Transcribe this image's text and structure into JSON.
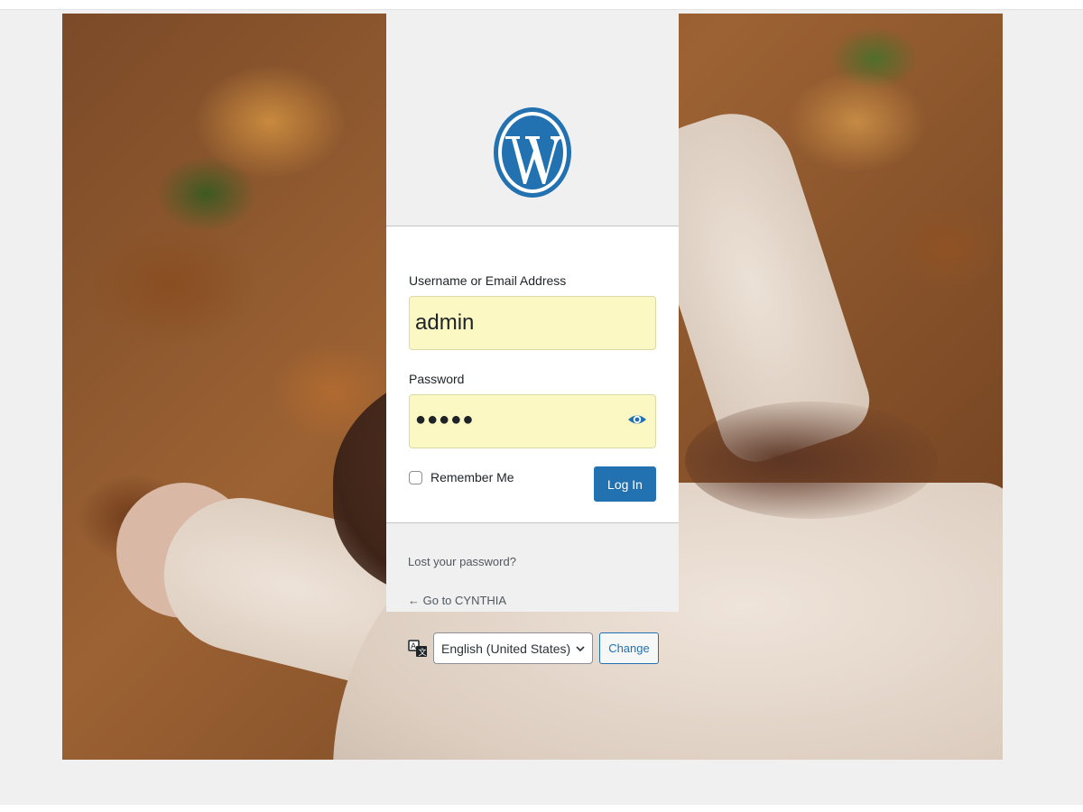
{
  "login": {
    "username_label": "Username or Email Address",
    "username_value": "admin",
    "password_label": "Password",
    "password_value": "●●●●●",
    "remember_label": "Remember Me",
    "login_button": "Log In"
  },
  "links": {
    "lost_password": "Lost your password?",
    "back_to_site": "← Go to CYNTHIA"
  },
  "language": {
    "selected": "English (United States)",
    "change_button": "Change"
  },
  "icons": {
    "logo": "wordpress-logo",
    "show_password": "eye-icon",
    "language": "translation-icon",
    "dropdown": "chevron-down-icon"
  },
  "colors": {
    "primary": "#2271b1",
    "autofill": "#fcf8c4",
    "background": "#f0f0f1"
  }
}
